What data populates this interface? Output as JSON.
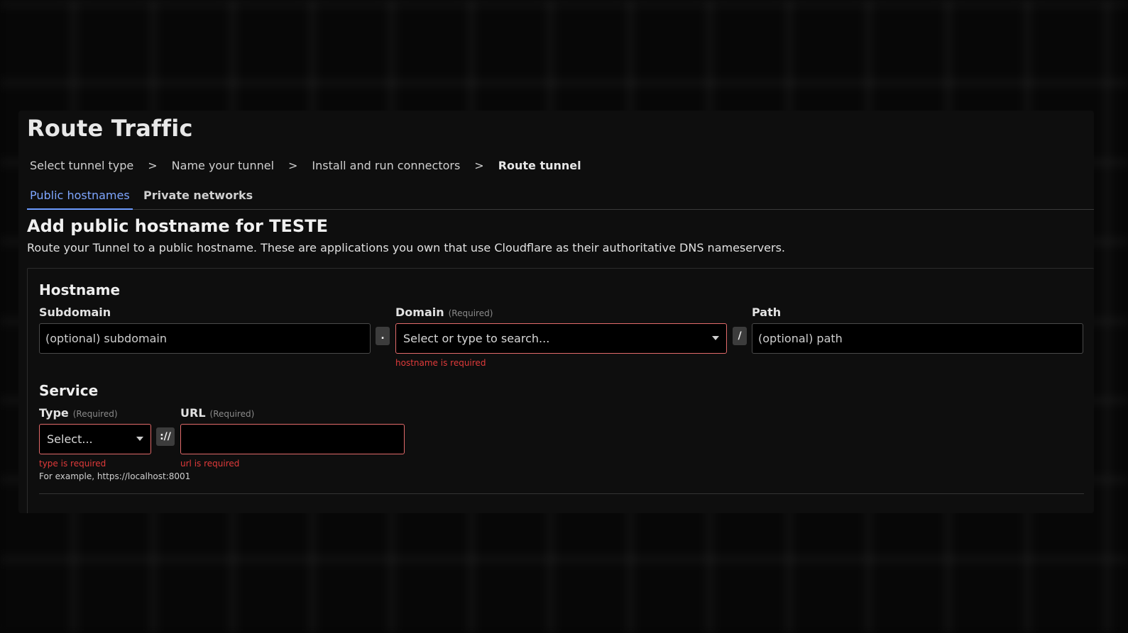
{
  "page": {
    "title": "Route Traffic"
  },
  "breadcrumb": {
    "steps": [
      "Select tunnel type",
      "Name your tunnel",
      "Install and run connectors",
      "Route tunnel"
    ],
    "separator": ">"
  },
  "tabs": {
    "items": [
      {
        "label": "Public hostnames",
        "active": true
      },
      {
        "label": "Private networks",
        "active": false
      }
    ]
  },
  "section": {
    "title": "Add public hostname for TESTE",
    "description": "Route your Tunnel to a public hostname. These are applications you own that use Cloudflare as their authoritative DNS nameservers."
  },
  "hostname": {
    "title": "Hostname",
    "subdomain": {
      "label": "Subdomain",
      "placeholder": "(optional) subdomain",
      "value": ""
    },
    "dot_joiner": ".",
    "domain": {
      "label": "Domain",
      "required": "(Required)",
      "placeholder": "Select or type to search...",
      "error": "hostname is required"
    },
    "slash_joiner": "/",
    "path": {
      "label": "Path",
      "placeholder": "(optional) path",
      "value": ""
    }
  },
  "service": {
    "title": "Service",
    "type": {
      "label": "Type",
      "required": "(Required)",
      "placeholder": "Select...",
      "error": "type is required"
    },
    "scheme_joiner": "://",
    "url": {
      "label": "URL",
      "required": "(Required)",
      "value": "",
      "error": "url is required"
    },
    "hint": "For example, https://localhost:8001"
  },
  "colors": {
    "accent": "#6c9bff",
    "error": "#e03a3a",
    "error_border": "#e26a6a",
    "panel_bg": "#0e0e0e"
  }
}
